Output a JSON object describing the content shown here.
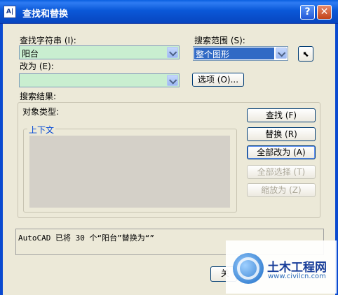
{
  "window": {
    "title": "查找和替换",
    "help": "?",
    "close": "✕",
    "icon_text": "A|"
  },
  "find": {
    "label": "查找字符串 (I):",
    "value": "阳台"
  },
  "scope": {
    "label": "搜索范围 (S):",
    "value": "整个图形"
  },
  "replace": {
    "label": "改为 (E):",
    "value": ""
  },
  "options_button": "选项 (O)...",
  "results": {
    "label": "搜索结果:",
    "object_type_label": "对象类型:",
    "context_label": "上下文"
  },
  "buttons": {
    "find": "查找 (F)",
    "replace": "替换 (R)",
    "replace_all": "全部改为 (A)",
    "select_all": "全部选择 (T)",
    "zoom_to": "缩放为 (Z)",
    "partial_close": "关"
  },
  "status_message": "AutoCAD 已将 30 个“阳台”替换为“”",
  "watermark": {
    "name": "土木工程网",
    "url": "www.civilcn.com"
  },
  "colors": {
    "titlebar": "#0a58d8",
    "dialog_bg": "#ece9d8",
    "input_green": "#c9eed0",
    "selection": "#316ac5"
  }
}
